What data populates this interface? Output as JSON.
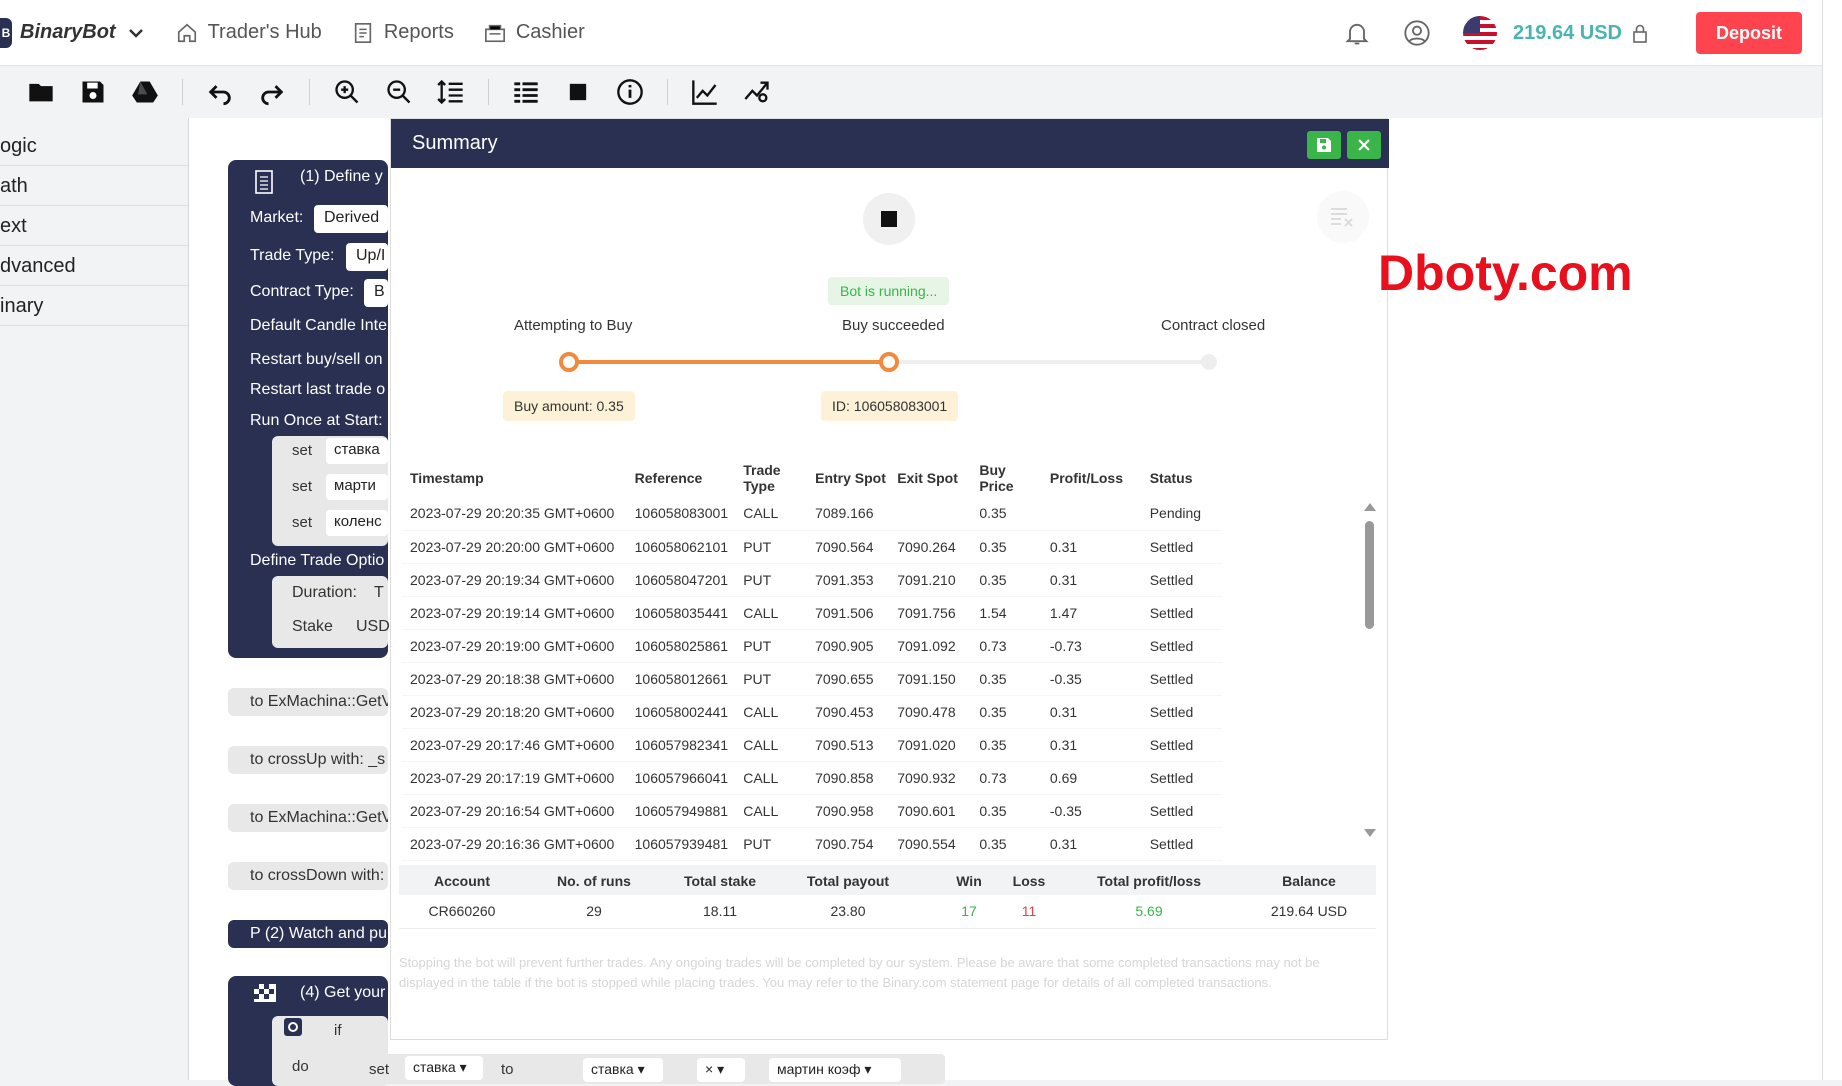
{
  "header": {
    "brand": "BinaryBot",
    "brand_letter": "B",
    "nav": [
      "Trader's Hub",
      "Reports",
      "Cashier"
    ],
    "balance": "219.64 USD",
    "deposit": "Deposit"
  },
  "sidebar": {
    "categories": [
      "ogic",
      "ath",
      "ext",
      "dvanced",
      "inary"
    ]
  },
  "workspace": {
    "define_title": "(1) Define y",
    "market_label": "Market:",
    "market_value": "Derived",
    "trade_type_label": "Trade Type:",
    "trade_type_value": "Up/I",
    "contract_type_label": "Contract Type:",
    "contract_type_value": "B",
    "candle_label": "Default Candle Inte",
    "restart_buysell": "Restart buy/sell on",
    "restart_last": "Restart last trade o",
    "run_once": "Run Once at Start:",
    "sets": [
      {
        "kw": "set",
        "var": "ставка"
      },
      {
        "kw": "set",
        "var": "марти"
      },
      {
        "kw": "set",
        "var": "коленс"
      }
    ],
    "define_trade": "Define Trade Optio",
    "duration_label": "Duration:",
    "duration_value": "T",
    "stake_label": "Stake",
    "stake_value": "USD",
    "pills": [
      "to ExMachina::GetV",
      "to crossUp with: _s",
      "to ExMachina::GetV",
      "to crossDown with:",
      "P (2) Watch and pu"
    ],
    "get_your": "(4) Get your",
    "if_kw": "if",
    "do_kw": "do",
    "set_kw": "set",
    "set_var": "ставка ▾",
    "to_kw": "to",
    "expr1": "ставка ▾",
    "expr_op": "× ▾",
    "expr2": "мартин коэф ▾"
  },
  "summary": {
    "title": "Summary",
    "status": "Bot is running...",
    "steps": [
      "Attempting to Buy",
      "Buy succeeded",
      "Contract closed"
    ],
    "buy_amount": "Buy amount: 0.35",
    "contract_id": "ID: 106058083001",
    "columns": [
      "Timestamp",
      "Reference",
      "Trade Type",
      "Entry Spot",
      "Exit Spot",
      "Buy Price",
      "Profit/Loss",
      "Status"
    ],
    "rows": [
      {
        "ts": "2023-07-29 20:20:35 GMT+0600",
        "ref": "106058083001",
        "type": "CALL",
        "entry": "7089.166",
        "exit": "",
        "buy": "0.35",
        "pl": "",
        "sign": "",
        "status": "Pending"
      },
      {
        "ts": "2023-07-29 20:20:00 GMT+0600",
        "ref": "106058062101",
        "type": "PUT",
        "entry": "7090.564",
        "exit": "7090.264",
        "buy": "0.35",
        "pl": "0.31",
        "sign": "pos",
        "status": "Settled"
      },
      {
        "ts": "2023-07-29 20:19:34 GMT+0600",
        "ref": "106058047201",
        "type": "PUT",
        "entry": "7091.353",
        "exit": "7091.210",
        "buy": "0.35",
        "pl": "0.31",
        "sign": "pos",
        "status": "Settled"
      },
      {
        "ts": "2023-07-29 20:19:14 GMT+0600",
        "ref": "106058035441",
        "type": "CALL",
        "entry": "7091.506",
        "exit": "7091.756",
        "buy": "1.54",
        "pl": "1.47",
        "sign": "pos",
        "status": "Settled"
      },
      {
        "ts": "2023-07-29 20:19:00 GMT+0600",
        "ref": "106058025861",
        "type": "PUT",
        "entry": "7090.905",
        "exit": "7091.092",
        "buy": "0.73",
        "pl": "-0.73",
        "sign": "neg",
        "status": "Settled"
      },
      {
        "ts": "2023-07-29 20:18:38 GMT+0600",
        "ref": "106058012661",
        "type": "PUT",
        "entry": "7090.655",
        "exit": "7091.150",
        "buy": "0.35",
        "pl": "-0.35",
        "sign": "neg",
        "status": "Settled"
      },
      {
        "ts": "2023-07-29 20:18:20 GMT+0600",
        "ref": "106058002441",
        "type": "CALL",
        "entry": "7090.453",
        "exit": "7090.478",
        "buy": "0.35",
        "pl": "0.31",
        "sign": "pos",
        "status": "Settled"
      },
      {
        "ts": "2023-07-29 20:17:46 GMT+0600",
        "ref": "106057982341",
        "type": "CALL",
        "entry": "7090.513",
        "exit": "7091.020",
        "buy": "0.35",
        "pl": "0.31",
        "sign": "pos",
        "status": "Settled"
      },
      {
        "ts": "2023-07-29 20:17:19 GMT+0600",
        "ref": "106057966041",
        "type": "CALL",
        "entry": "7090.858",
        "exit": "7090.932",
        "buy": "0.73",
        "pl": "0.69",
        "sign": "pos",
        "status": "Settled"
      },
      {
        "ts": "2023-07-29 20:16:54 GMT+0600",
        "ref": "106057949881",
        "type": "CALL",
        "entry": "7090.958",
        "exit": "7090.601",
        "buy": "0.35",
        "pl": "-0.35",
        "sign": "neg",
        "status": "Settled"
      },
      {
        "ts": "2023-07-29 20:16:36 GMT+0600",
        "ref": "106057939481",
        "type": "PUT",
        "entry": "7090.754",
        "exit": "7090.554",
        "buy": "0.35",
        "pl": "0.31",
        "sign": "pos",
        "status": "Settled"
      }
    ],
    "totals_columns": [
      "Account",
      "No. of runs",
      "Total stake",
      "Total payout",
      "Win",
      "Loss",
      "Total profit/loss",
      "Balance"
    ],
    "totals": {
      "account": "CR660260",
      "runs": "29",
      "stake": "18.11",
      "payout": "23.80",
      "win": "17",
      "loss": "11",
      "profit": "5.69",
      "balance": "219.64 USD"
    },
    "disclaimer": "Stopping the bot will prevent further trades. Any ongoing trades will be completed by our system. Please be aware that some completed transactions may not be displayed in the table if the bot is stopped while placing trades. You may refer to the Binary.com statement page for details of all completed transactions."
  },
  "watermark": "Dboty.com",
  "colors": {
    "brand_navy": "#2a3052",
    "accent_green": "#39b54a",
    "loss_red": "#ec3f3f",
    "progress_orange": "#f08a3c",
    "deposit_red": "#ff444f",
    "balance_teal": "#4bb4b3"
  }
}
